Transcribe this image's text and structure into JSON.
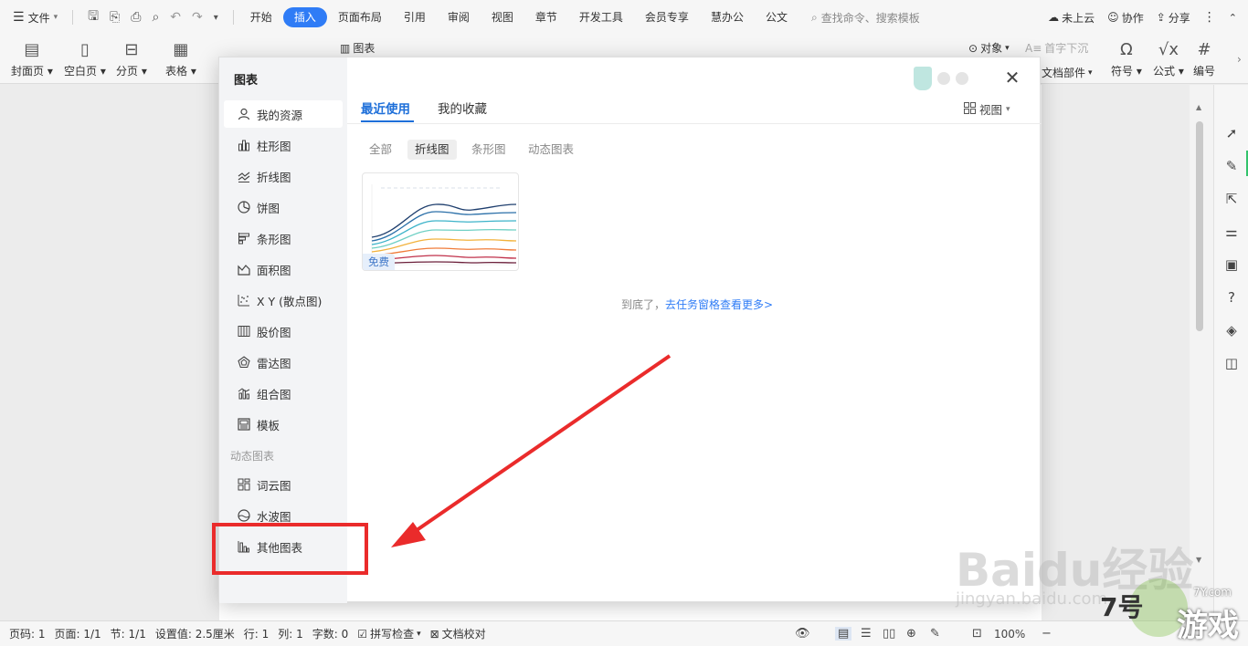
{
  "menubar": {
    "file_label": "文件",
    "tabs": [
      "开始",
      "插入",
      "页面布局",
      "引用",
      "审阅",
      "视图",
      "章节",
      "开发工具",
      "会员专享",
      "慧办公",
      "公文"
    ],
    "active_tab": "插入",
    "search_placeholder": "查找命令、搜索模板",
    "cloud_label": "未上云",
    "collab_label": "协作",
    "share_label": "分享"
  },
  "ribbon": {
    "cover_label": "封面页",
    "blank_label": "空白页",
    "pagebreak_label": "分页",
    "table_label": "表格",
    "chart_label": "图表",
    "object_label": "对象",
    "dropcap_label": "首字下沉",
    "docparts_label": "文档部件",
    "symbol_label": "符号",
    "formula_label": "公式",
    "numbering_label": "编号"
  },
  "dialog": {
    "title": "图表",
    "nav_items": [
      {
        "label": "我的资源",
        "icon": "user-icon"
      },
      {
        "label": "柱形图",
        "icon": "column-chart-icon"
      },
      {
        "label": "折线图",
        "icon": "line-chart-icon"
      },
      {
        "label": "饼图",
        "icon": "pie-chart-icon"
      },
      {
        "label": "条形图",
        "icon": "bar-chart-icon"
      },
      {
        "label": "面积图",
        "icon": "area-chart-icon"
      },
      {
        "label": "X Y (散点图)",
        "icon": "scatter-chart-icon"
      },
      {
        "label": "股价图",
        "icon": "stock-chart-icon"
      },
      {
        "label": "雷达图",
        "icon": "radar-chart-icon"
      },
      {
        "label": "组合图",
        "icon": "combo-chart-icon"
      },
      {
        "label": "模板",
        "icon": "template-icon"
      }
    ],
    "group_dynamic": "动态图表",
    "dynamic_items": [
      {
        "label": "词云图",
        "icon": "wordcloud-icon"
      },
      {
        "label": "水波图",
        "icon": "wave-icon"
      }
    ],
    "other_item": {
      "label": "其他图表",
      "icon": "other-chart-icon"
    },
    "tabs": [
      "最近使用",
      "我的收藏"
    ],
    "view_label": "视图",
    "filters": [
      "全部",
      "折线图",
      "条形图",
      "动态图表"
    ],
    "active_filter": "折线图",
    "card_badge": "免费",
    "end_text": "到底了，",
    "end_link": "去任务窗格查看更多>"
  },
  "statusbar": {
    "page_no": "页码: 1",
    "pages": "页面: 1/1",
    "section": "节: 1/1",
    "setting": "设置值: 2.5厘米",
    "row": "行: 1",
    "col": "列: 1",
    "words": "字数: 0",
    "spell_check": "拼写检查",
    "doc_proof": "文档校对",
    "zoom": "100%"
  },
  "watermark": {
    "baidu_text": "Baidu经验",
    "jingyan_text": "jingyan.baidu.com",
    "logo_num": "7号",
    "logo_text": "游戏",
    "logo_site": "7Y.com"
  }
}
